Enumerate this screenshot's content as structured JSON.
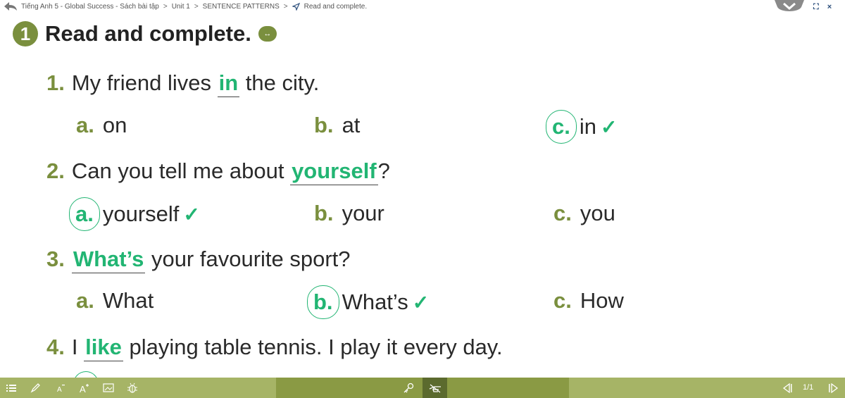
{
  "breadcrumb": {
    "items": [
      "Tiếng Anh 5 - Global Success - Sách bài tập",
      "Unit 1",
      "SENTENCE PATTERNS",
      "Read and complete."
    ],
    "separator": ">"
  },
  "window_icons": {
    "expand": "⛶",
    "close": "×"
  },
  "exercise": {
    "number": "1",
    "title": "Read and complete.",
    "audio_icon": "↔"
  },
  "questions": [
    {
      "number": "1.",
      "before": "My friend lives",
      "answer": "in",
      "after": "the city.",
      "options": [
        {
          "letter": "a.",
          "text": "on",
          "selected": false
        },
        {
          "letter": "b.",
          "text": "at",
          "selected": false
        },
        {
          "letter": "c.",
          "text": "in",
          "selected": true
        }
      ]
    },
    {
      "number": "2.",
      "before": "Can you tell me about",
      "answer": "yourself",
      "after": "?",
      "options": [
        {
          "letter": "a.",
          "text": "yourself",
          "selected": true
        },
        {
          "letter": "b.",
          "text": "your",
          "selected": false
        },
        {
          "letter": "c.",
          "text": "you",
          "selected": false
        }
      ]
    },
    {
      "number": "3.",
      "before": "",
      "answer": "What’s",
      "after": "your favourite sport?",
      "options": [
        {
          "letter": "a.",
          "text": "What",
          "selected": false
        },
        {
          "letter": "b.",
          "text": "What’s",
          "selected": true
        },
        {
          "letter": "c.",
          "text": "How",
          "selected": false
        }
      ]
    },
    {
      "number": "4.",
      "before": "I",
      "answer": "like",
      "after": "playing table tennis. I play it every day.",
      "options": []
    }
  ],
  "check_mark": "✓",
  "toolbar": {
    "page_indicator": "1/1",
    "colors": {
      "bar": "#a6b466",
      "mid": "#8a9a44",
      "active": "#5b6a2e"
    }
  },
  "colors": {
    "accent_olive": "#7a8f3e",
    "answer_green": "#22b573"
  }
}
